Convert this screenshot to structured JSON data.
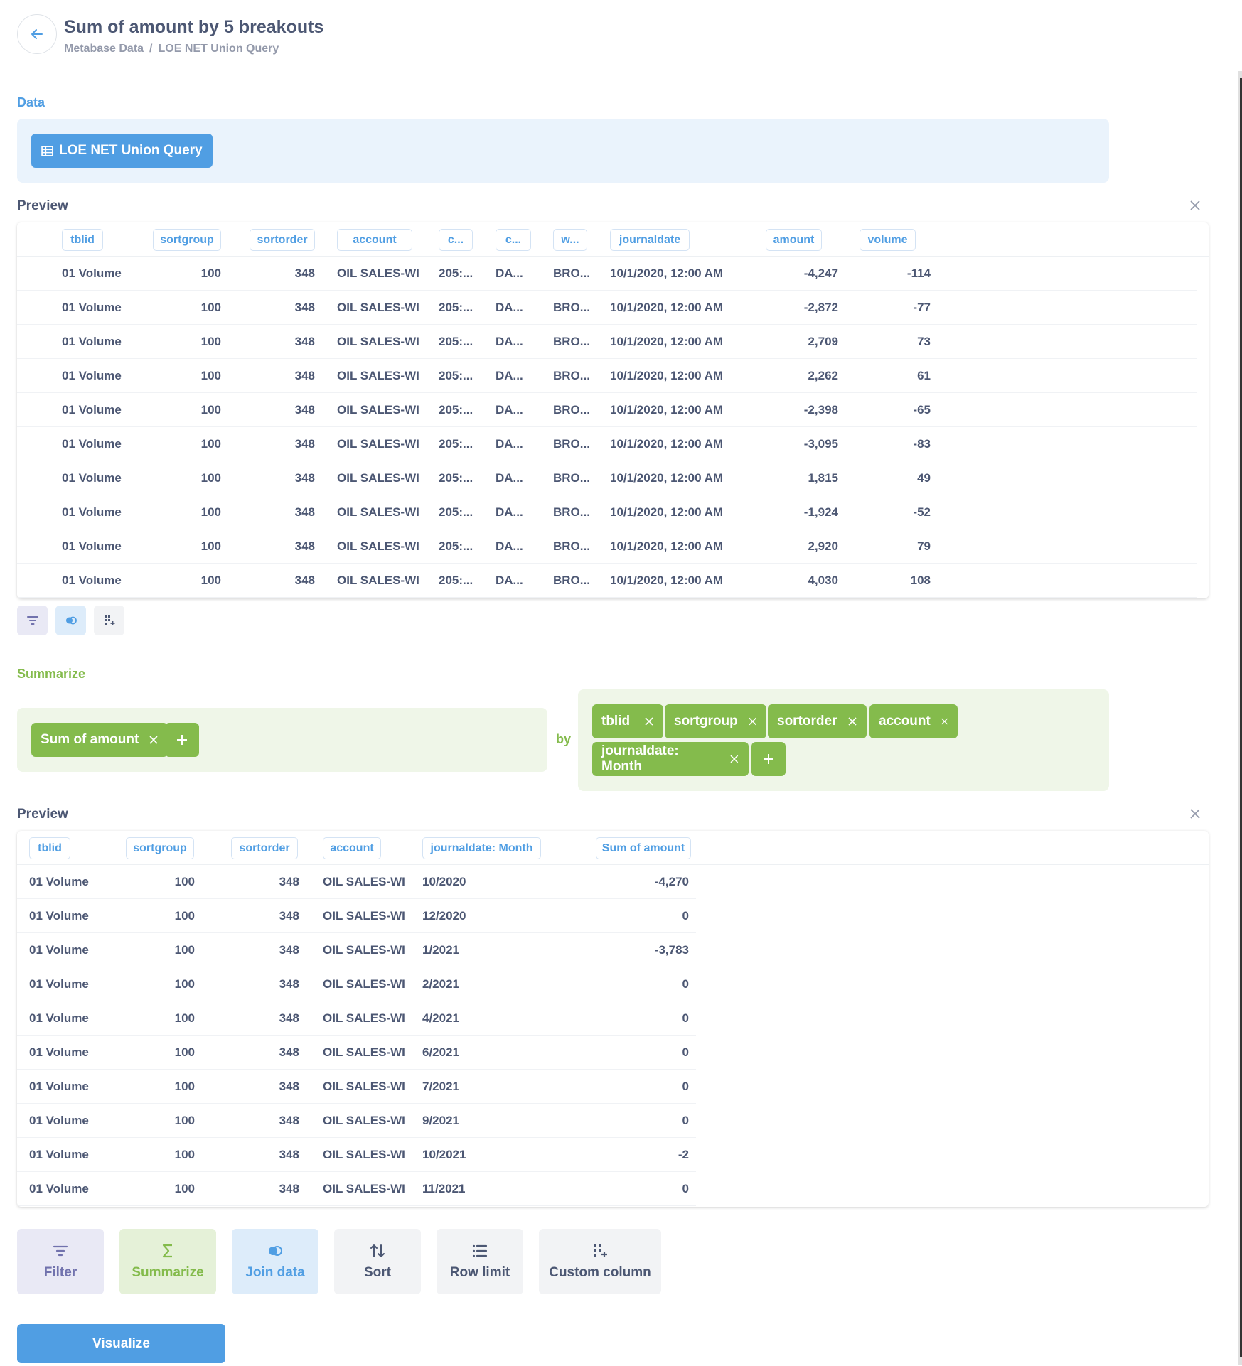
{
  "header": {
    "title": "Sum of amount by 5 breakouts",
    "breadcrumb": [
      "Metabase Data",
      "/",
      "LOE NET Union Query"
    ]
  },
  "data_section": {
    "label": "Data",
    "source": "LOE NET Union Query"
  },
  "preview1": {
    "label": "Preview",
    "columns": [
      "tblid",
      "sortgroup",
      "sortorder",
      "account",
      "c...",
      "c...",
      "w...",
      "journaldate",
      "amount",
      "volume"
    ],
    "rows": [
      [
        "01 Volume",
        "100",
        "348",
        "OIL SALES-WI",
        "205:...",
        "DA...",
        "BRO...",
        "10/1/2020, 12:00 AM",
        "-4,247",
        "-114"
      ],
      [
        "01 Volume",
        "100",
        "348",
        "OIL SALES-WI",
        "205:...",
        "DA...",
        "BRO...",
        "10/1/2020, 12:00 AM",
        "-2,872",
        "-77"
      ],
      [
        "01 Volume",
        "100",
        "348",
        "OIL SALES-WI",
        "205:...",
        "DA...",
        "BRO...",
        "10/1/2020, 12:00 AM",
        "2,709",
        "73"
      ],
      [
        "01 Volume",
        "100",
        "348",
        "OIL SALES-WI",
        "205:...",
        "DA...",
        "BRO...",
        "10/1/2020, 12:00 AM",
        "2,262",
        "61"
      ],
      [
        "01 Volume",
        "100",
        "348",
        "OIL SALES-WI",
        "205:...",
        "DA...",
        "BRO...",
        "10/1/2020, 12:00 AM",
        "-2,398",
        "-65"
      ],
      [
        "01 Volume",
        "100",
        "348",
        "OIL SALES-WI",
        "205:...",
        "DA...",
        "BRO...",
        "10/1/2020, 12:00 AM",
        "-3,095",
        "-83"
      ],
      [
        "01 Volume",
        "100",
        "348",
        "OIL SALES-WI",
        "205:...",
        "DA...",
        "BRO...",
        "10/1/2020, 12:00 AM",
        "1,815",
        "49"
      ],
      [
        "01 Volume",
        "100",
        "348",
        "OIL SALES-WI",
        "205:...",
        "DA...",
        "BRO...",
        "10/1/2020, 12:00 AM",
        "-1,924",
        "-52"
      ],
      [
        "01 Volume",
        "100",
        "348",
        "OIL SALES-WI",
        "205:...",
        "DA...",
        "BRO...",
        "10/1/2020, 12:00 AM",
        "2,920",
        "79"
      ],
      [
        "01 Volume",
        "100",
        "348",
        "OIL SALES-WI",
        "205:...",
        "DA...",
        "BRO...",
        "10/1/2020, 12:00 AM",
        "4,030",
        "108"
      ]
    ]
  },
  "summarize": {
    "label": "Summarize",
    "metric": "Sum of amount",
    "by": "by",
    "breakouts": [
      "tblid",
      "sortgroup",
      "sortorder",
      "account",
      "journaldate: Month"
    ]
  },
  "preview2": {
    "label": "Preview",
    "columns": [
      "tblid",
      "sortgroup",
      "sortorder",
      "account",
      "journaldate: Month",
      "Sum of amount"
    ],
    "rows": [
      [
        "01 Volume",
        "100",
        "348",
        "OIL SALES-WI",
        "10/2020",
        "-4,270"
      ],
      [
        "01 Volume",
        "100",
        "348",
        "OIL SALES-WI",
        "12/2020",
        "0"
      ],
      [
        "01 Volume",
        "100",
        "348",
        "OIL SALES-WI",
        "1/2021",
        "-3,783"
      ],
      [
        "01 Volume",
        "100",
        "348",
        "OIL SALES-WI",
        "2/2021",
        "0"
      ],
      [
        "01 Volume",
        "100",
        "348",
        "OIL SALES-WI",
        "4/2021",
        "0"
      ],
      [
        "01 Volume",
        "100",
        "348",
        "OIL SALES-WI",
        "6/2021",
        "0"
      ],
      [
        "01 Volume",
        "100",
        "348",
        "OIL SALES-WI",
        "7/2021",
        "0"
      ],
      [
        "01 Volume",
        "100",
        "348",
        "OIL SALES-WI",
        "9/2021",
        "0"
      ],
      [
        "01 Volume",
        "100",
        "348",
        "OIL SALES-WI",
        "10/2021",
        "-2"
      ],
      [
        "01 Volume",
        "100",
        "348",
        "OIL SALES-WI",
        "11/2021",
        "0"
      ]
    ]
  },
  "actions": {
    "filter": "Filter",
    "summarize": "Summarize",
    "join": "Join data",
    "sort": "Sort",
    "row_limit": "Row limit",
    "custom_column": "Custom column"
  },
  "visualize": "Visualize",
  "colors": {
    "brand": "#509ee3",
    "summarize": "#84bb4c",
    "filter": "#7172ad",
    "text": "#4c5773"
  }
}
